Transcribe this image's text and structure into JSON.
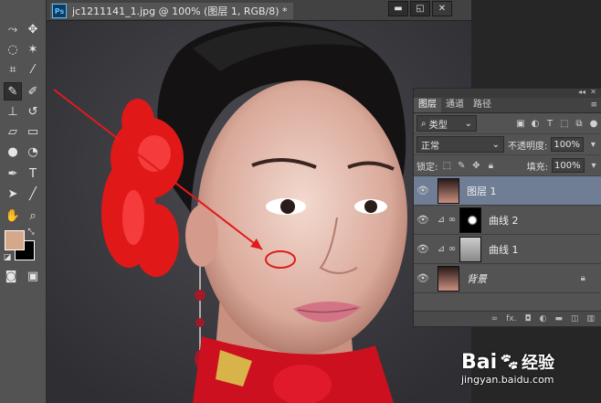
{
  "document_tab": {
    "app_badge": "Ps",
    "title": "jc1211141_1.jpg @ 100% (图层 1, RGB/8) *"
  },
  "window_controls": {
    "minimize": "▬",
    "restore": "◱",
    "close": "✕"
  },
  "tools": [
    "lasso-icon",
    "move-icon",
    "polygon-lasso-icon",
    "magic-wand-icon",
    "crop-icon",
    "eyedropper-icon",
    "spot-healing-brush-icon",
    "brush-icon",
    "clone-stamp-icon",
    "history-brush-icon",
    "eraser-icon",
    "gradient-icon",
    "blur-icon",
    "dodge-icon",
    "pen-icon",
    "type-icon",
    "path-selection-icon",
    "line-icon",
    "hand-icon",
    "zoom-icon"
  ],
  "colors": {
    "foreground": "#d6a88a",
    "background": "#000000",
    "selection_highlight": "#6f7d95",
    "annotation_red": "#e11b1b"
  },
  "layers_panel": {
    "tabs": [
      "图层",
      "通道",
      "路径"
    ],
    "filter_select": "类型",
    "blend_mode": "正常",
    "opacity_label": "不透明度:",
    "opacity_value": "100%",
    "lock_label": "锁定:",
    "fill_label": "填充:",
    "fill_value": "100%",
    "layers": [
      {
        "name": "图层 1",
        "selected": true,
        "type": "pixel"
      },
      {
        "name": "曲线 2",
        "selected": false,
        "type": "adjustment"
      },
      {
        "name": "曲线 1",
        "selected": false,
        "type": "adjustment"
      },
      {
        "name": "背景",
        "selected": false,
        "type": "background",
        "locked": true
      }
    ],
    "bottom_icons": [
      "link-icon",
      "fx-icon",
      "mask-icon",
      "adjustment-icon",
      "folder-icon",
      "new-layer-icon",
      "trash-icon"
    ],
    "bottom_fx": "fx."
  },
  "watermark": {
    "brand": "Bai",
    "brand2": "经验",
    "url": "jingyan.baidu.com"
  }
}
